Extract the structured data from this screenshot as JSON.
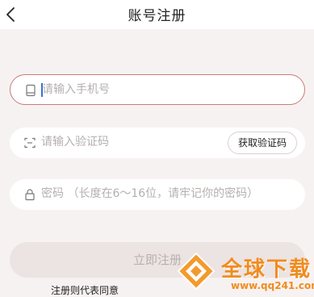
{
  "header": {
    "title": "账号注册"
  },
  "form": {
    "phone_placeholder": "请输入手机号",
    "code_placeholder": "请输入验证码",
    "get_code_label": "获取验证码",
    "password_placeholder": "密码 （长度在6～16位，请牢记你的密码）",
    "submit_label": "立即注册",
    "agreement_text": "注册则代表同意"
  },
  "watermark": {
    "name": "全球下载",
    "url": "www.qq241.com"
  },
  "colors": {
    "accent_border": "#c97d78",
    "watermark": "#f08c1f",
    "button_bg": "#ece3e3"
  }
}
